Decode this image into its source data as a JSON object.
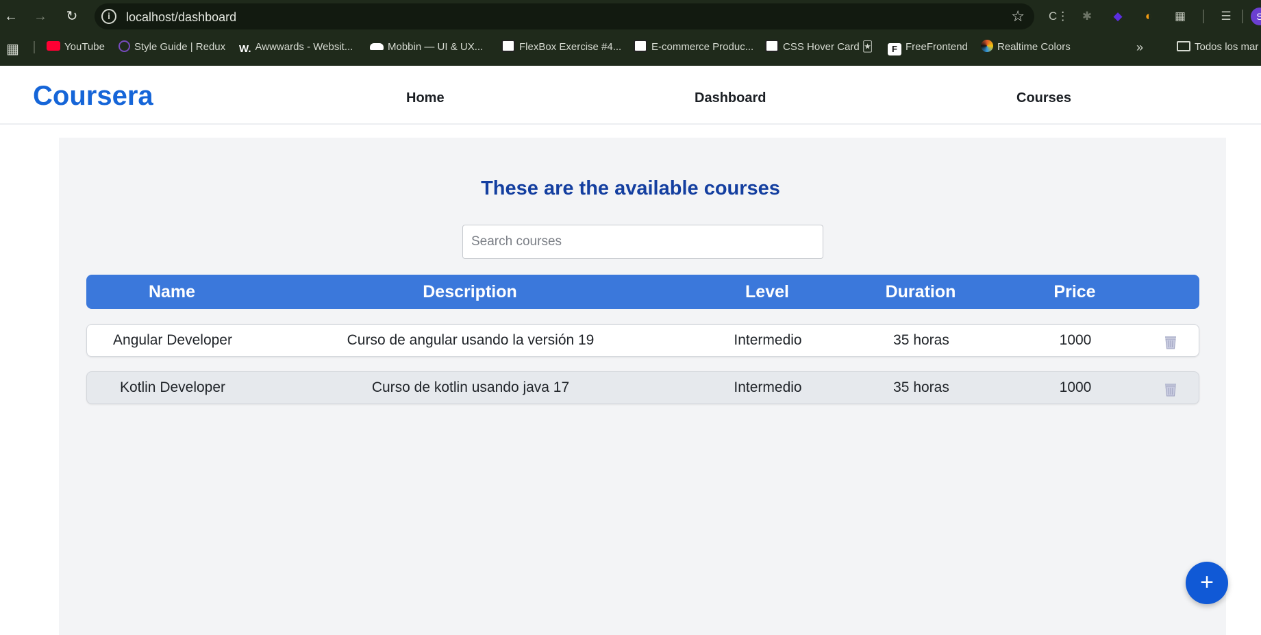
{
  "browser": {
    "url": "localhost/dashboard",
    "bookmarks": [
      {
        "label": "YouTube",
        "icon": "youtube-icon",
        "color": "#ff0033"
      },
      {
        "label": "Style Guide | Redux",
        "icon": "redux-icon",
        "color": "#764abc"
      },
      {
        "label": "Awwwards - Websit...",
        "icon": "awwwards-icon",
        "color": "#ffffff"
      },
      {
        "label": "Mobbin — UI & UX...",
        "icon": "mobbin-icon",
        "color": "#ffffff"
      },
      {
        "label": "FlexBox Exercise #4...",
        "icon": "codepen-icon",
        "color": "#ffffff"
      },
      {
        "label": "E-commerce Produc...",
        "icon": "codepen-icon",
        "color": "#ffffff"
      },
      {
        "label": "CSS Hover Card 🃏",
        "icon": "codepen-icon",
        "color": "#ffffff"
      },
      {
        "label": "FreeFrontend",
        "icon": "freefrontend-icon",
        "color": "#ffffff"
      },
      {
        "label": "Realtime Colors",
        "icon": "realtime-colors-icon",
        "color": "#e05a2b"
      }
    ],
    "overflow_label": "»",
    "folder_label": "Todos los mar",
    "profile_initial": "S"
  },
  "header": {
    "logo": "Coursera",
    "nav": [
      "Home",
      "Dashboard",
      "Courses"
    ]
  },
  "main": {
    "heading": "These are the available courses",
    "search_placeholder": "Search courses",
    "columns": [
      "Name",
      "Description",
      "Level",
      "Duration",
      "Price"
    ],
    "rows": [
      {
        "name": "Angular Developer",
        "description": "Curso de angular usando la versión 19",
        "level": "Intermedio",
        "duration": "35 horas",
        "price": "1000"
      },
      {
        "name": "Kotlin Developer",
        "description": "Curso de kotlin usando java 17",
        "level": "Intermedio",
        "duration": "35 horas",
        "price": "1000"
      }
    ],
    "fab_label": "+"
  },
  "colors": {
    "brand": "#1565d8",
    "table_header": "#3b78db",
    "heading": "#143fa0",
    "fab": "#1059d6"
  }
}
